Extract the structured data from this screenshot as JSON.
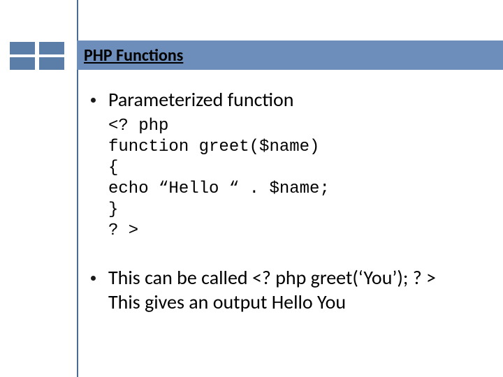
{
  "header": {
    "title": "PHP Functions"
  },
  "bullets": {
    "b1": "Parameterized function",
    "b2_line1": "This can be called <? php greet(‘You’); ? >",
    "b2_line2": "This gives an output Hello You"
  },
  "code": {
    "l1": "<? php",
    "l2": "function greet($name)",
    "l3": "{",
    "l4": "echo “Hello “ . $name;",
    "l5": "}",
    "l6": "? >"
  }
}
